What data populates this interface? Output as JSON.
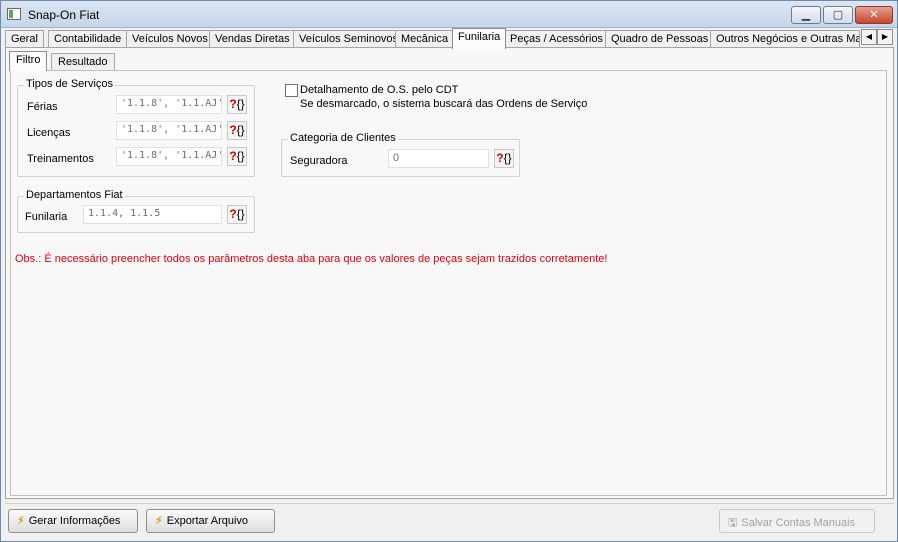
{
  "window": {
    "title": "Snap-On Fiat",
    "minimize_label": "▁",
    "maximize_label": "▢",
    "close_label": "✕"
  },
  "main_tabs": [
    {
      "label": "Geral"
    },
    {
      "label": "Contabilidade"
    },
    {
      "label": "Veículos Novos"
    },
    {
      "label": "Vendas Diretas"
    },
    {
      "label": "Veículos Seminovos"
    },
    {
      "label": "Mecânica"
    },
    {
      "label": "Funilaria",
      "active": true
    },
    {
      "label": "Peças / Acessórios"
    },
    {
      "label": "Quadro de Pessoas"
    },
    {
      "label": "Outros Negócios e Outras Mar"
    }
  ],
  "tab_scroll": {
    "left": "◀",
    "right": "▶"
  },
  "sub_tabs": [
    {
      "label": "Filtro",
      "active": true
    },
    {
      "label": "Resultado"
    }
  ],
  "tipos_servicos": {
    "title": "Tipos de Serviços",
    "rows": [
      {
        "label": "Férias",
        "value": "'1.1.8', '1.1.AJ'"
      },
      {
        "label": "Licenças",
        "value": "'1.1.8', '1.1.AJ'"
      },
      {
        "label": "Treinamentos",
        "value": "'1.1.8', '1.1.AJ'"
      }
    ]
  },
  "departamentos": {
    "title": "Departamentos Fiat",
    "label": "Funilaria",
    "value": "1.1.4, 1.1.5"
  },
  "detalhamento": {
    "label": "Detalhamento de O.S. pelo CDT",
    "note": "Se desmarcado, o sistema buscará das Ordens de Serviço",
    "checked": false
  },
  "categoria": {
    "title": "Categoria de Clientes",
    "label": "Seguradora",
    "value": "0"
  },
  "lookup_icon": {
    "q": "?",
    "b": "{}"
  },
  "obs": "Obs.: É necessário preencher todos os parâmetros desta aba para que os valores de peças sejam trazidos corretamente!",
  "buttons": {
    "gerar": "Gerar Informações",
    "exportar": "Exportar Arquivo",
    "salvar": "Salvar Contas Manuais"
  },
  "colors": {
    "obs_text": "#e0000f",
    "lookup_q": "#d10000",
    "bolt": "#e7b400"
  }
}
